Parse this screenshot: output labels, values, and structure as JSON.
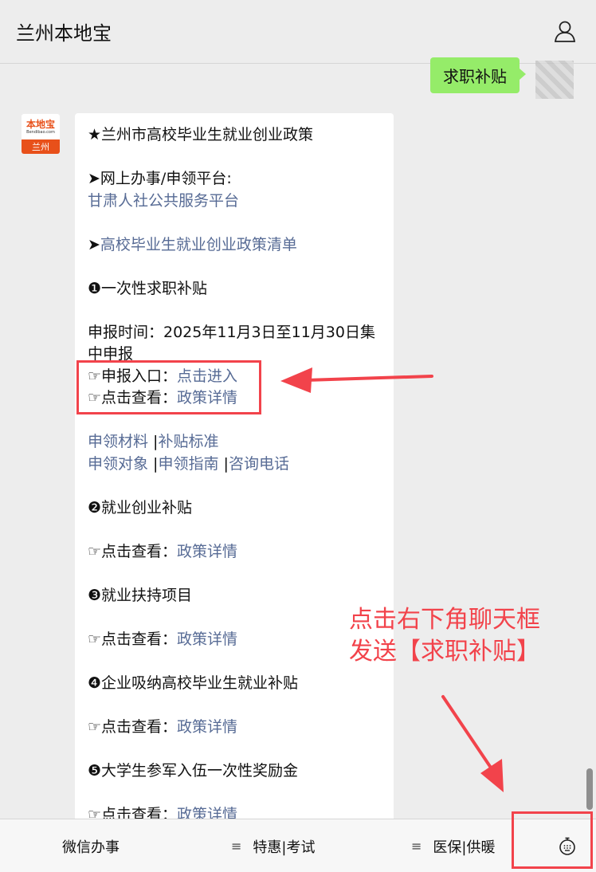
{
  "header": {
    "title": "兰州本地宝"
  },
  "sent_message": {
    "text": "求职补贴"
  },
  "account_avatar": {
    "logo_text": "本地宝",
    "domain_text": "Bendibao.com",
    "city_text": "兰州"
  },
  "message": {
    "policy_title": "★兰州市高校毕业生就业创业政策",
    "platform_label": "➤网上办事/申领平台:",
    "platform_link": "甘肃人社公共服务平台",
    "list_arrow": "➤",
    "list_link": "高校毕业生就业创业政策清单",
    "s1_title": "❶一次性求职补贴",
    "s1_time": "申报时间：2025年11月3日至11月30日集中申报",
    "s1_entry_label": "☞申报入口：",
    "s1_entry_link": "点击进入",
    "s1_view_label": "☞点击查看：",
    "s1_view_link": "政策详情",
    "link_materials": "申领材料",
    "sep1": " |",
    "link_standard": "补贴标准",
    "link_target": "申领对象",
    "sep2": " |",
    "link_guide": "申领指南",
    "sep3": " |",
    "link_phone": "咨询电话",
    "s2_title": "❷就业创业补贴",
    "s2_view_label": "☞点击查看：",
    "s2_view_link": "政策详情",
    "s3_title": "❸就业扶持项目",
    "s3_view_label": "☞点击查看：",
    "s3_view_link": "政策详情",
    "s4_title": "❹企业吸纳高校毕业生就业补贴",
    "s4_view_label": "☞点击查看：",
    "s4_view_link": "政策详情",
    "s5_title": "❺大学生参军入伍一次性奖励金",
    "s5_view_label": "☞点击查看：",
    "s5_view_link": "政策详情"
  },
  "annotation": {
    "line1": "点击右下角聊天框",
    "line2": "发送【求职补贴】"
  },
  "bottom_menu": {
    "item1": "微信办事",
    "item2": "特惠|考试",
    "item3": "医保|供暖",
    "menu_glyph": "≡"
  },
  "colors": {
    "accent_red": "#f2434b",
    "link_blue": "#576b95",
    "sent_green": "#95ec69",
    "brand_orange": "#e8501a"
  },
  "icons": {
    "profile": "person-icon",
    "keyboard": "keyboard-icon"
  }
}
